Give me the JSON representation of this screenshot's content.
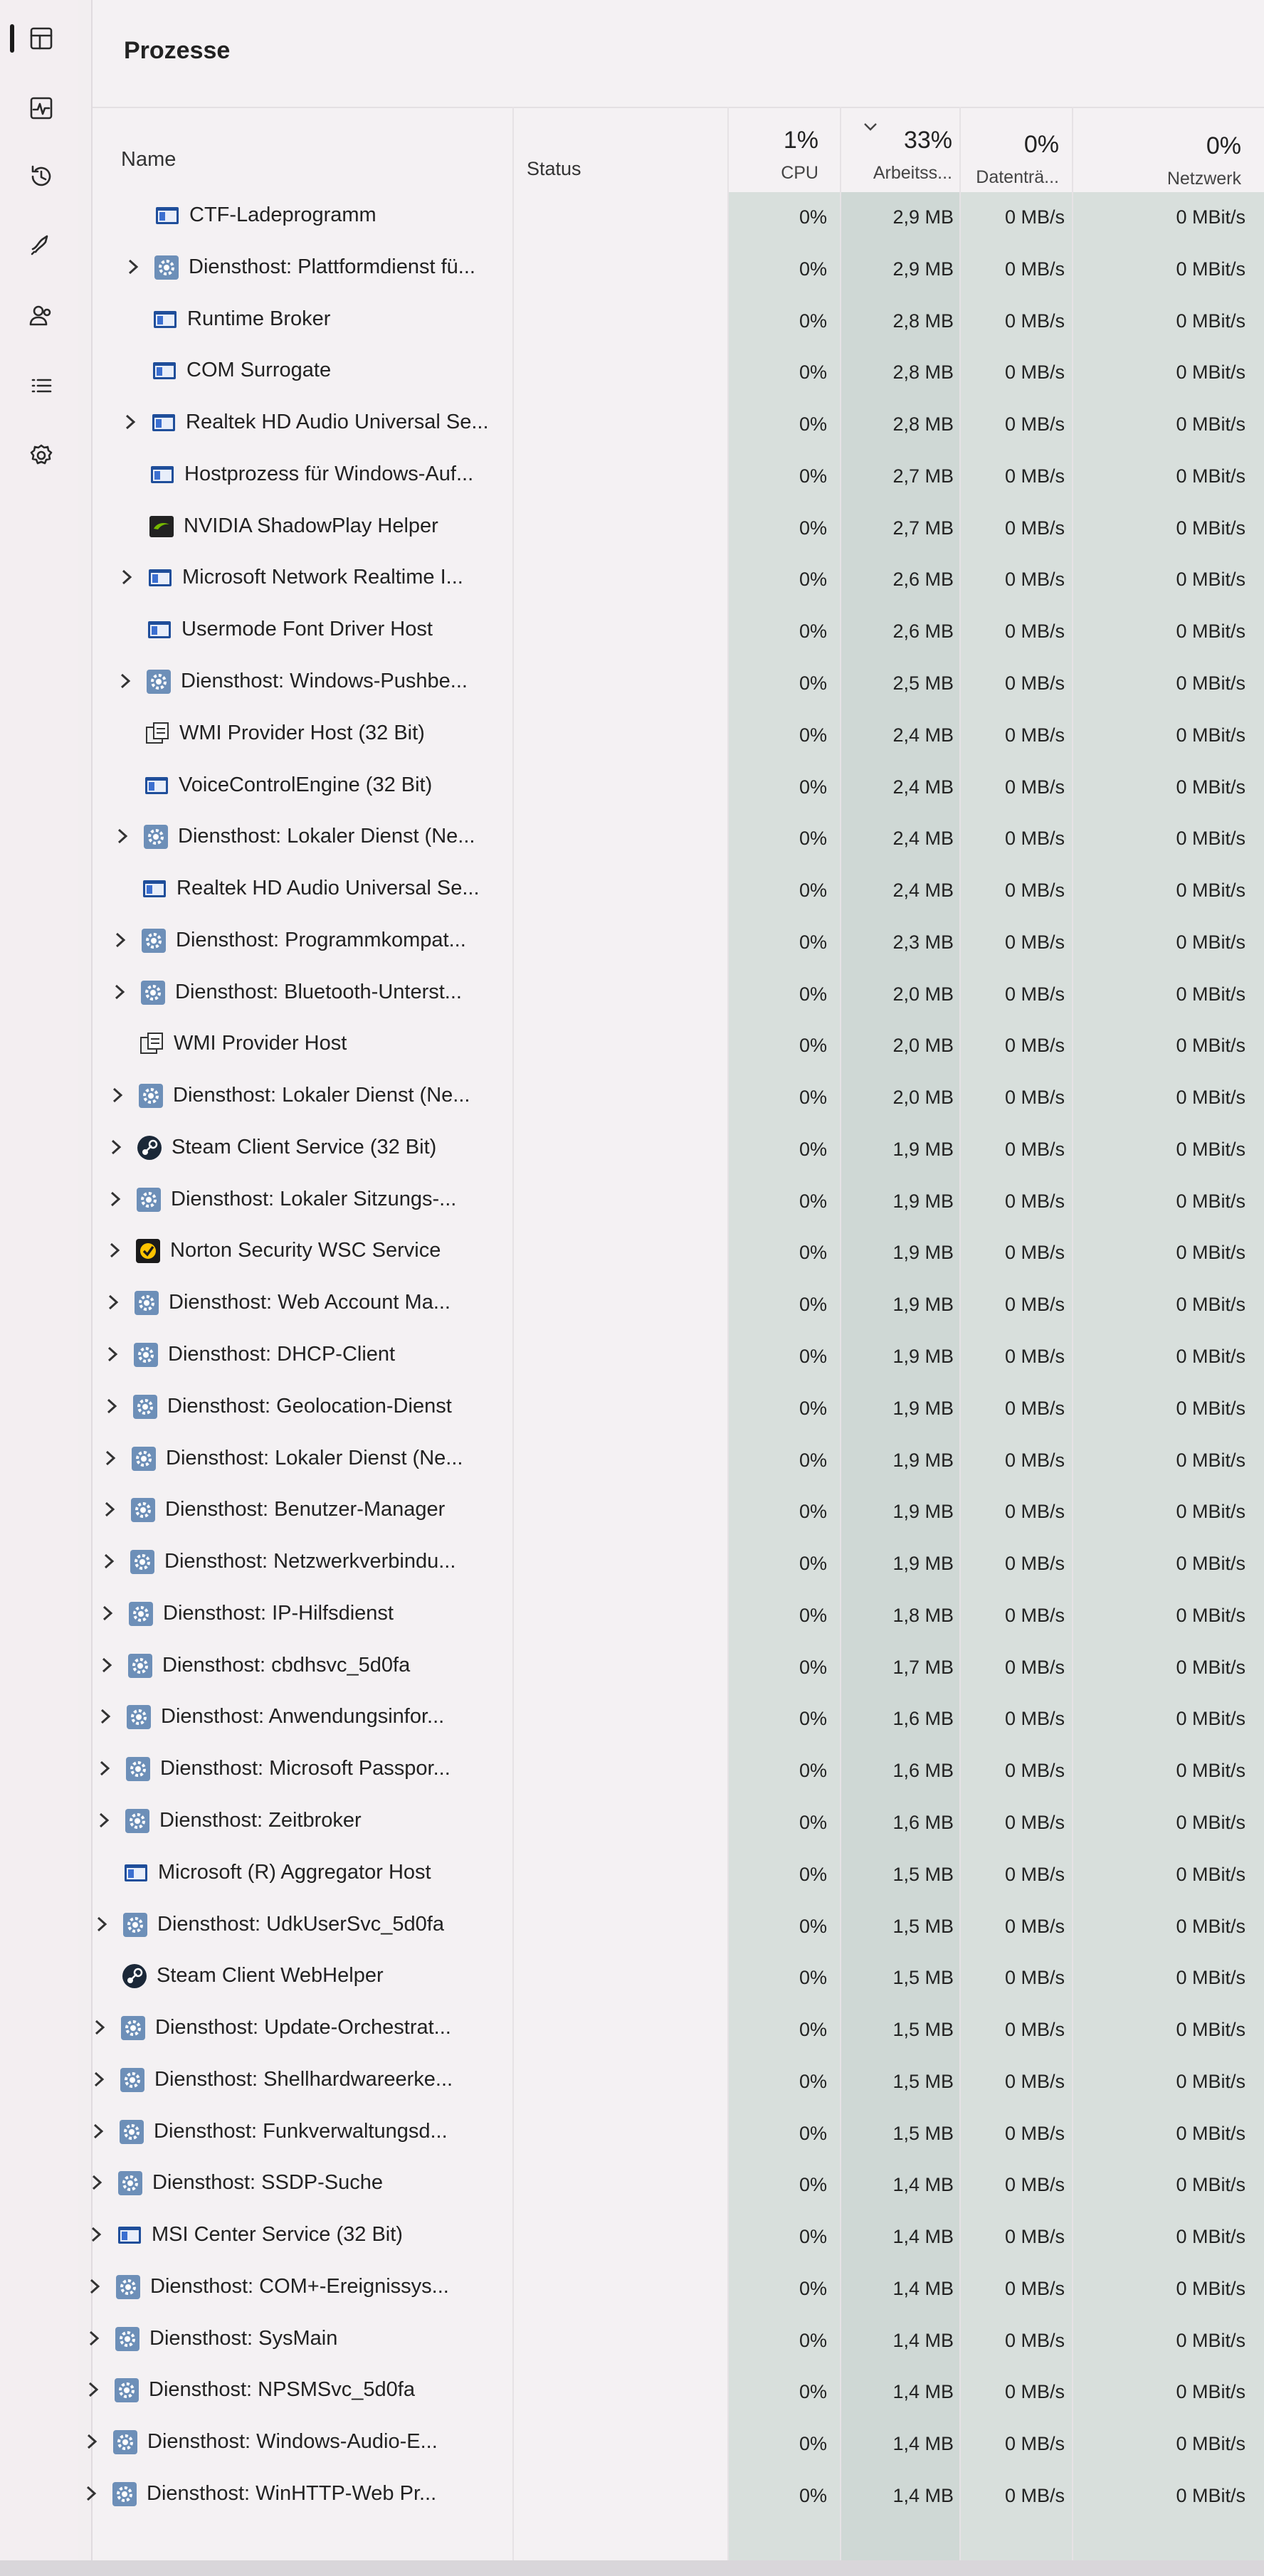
{
  "header": {
    "title": "Prozesse",
    "columns": {
      "name": "Name",
      "status": "Status",
      "cpu": {
        "pct": "1%",
        "label": "CPU"
      },
      "memory": {
        "pct": "33%",
        "label": "Arbeitss..."
      },
      "disk": {
        "pct": "0%",
        "label": "Datenträ..."
      },
      "network": {
        "pct": "0%",
        "label": "Netzwerk"
      }
    }
  },
  "nav": [
    {
      "name": "processes-icon"
    },
    {
      "name": "performance-icon"
    },
    {
      "name": "app-history-icon"
    },
    {
      "name": "startup-apps-icon"
    },
    {
      "name": "users-icon"
    },
    {
      "name": "details-icon"
    },
    {
      "name": "services-icon"
    }
  ],
  "rows": [
    {
      "name": "CTF-Ladeprogramm",
      "expand": false,
      "icon": "window-icon",
      "cpu": "0%",
      "mem": "2,9 MB",
      "disk": "0 MB/s",
      "net": "0 MBit/s"
    },
    {
      "name": "Diensthost: Plattformdienst fü...",
      "expand": true,
      "icon": "service-gear-icon",
      "cpu": "0%",
      "mem": "2,9 MB",
      "disk": "0 MB/s",
      "net": "0 MBit/s"
    },
    {
      "name": "Runtime Broker",
      "expand": false,
      "icon": "window-icon",
      "cpu": "0%",
      "mem": "2,8 MB",
      "disk": "0 MB/s",
      "net": "0 MBit/s"
    },
    {
      "name": "COM Surrogate",
      "expand": false,
      "icon": "window-icon",
      "cpu": "0%",
      "mem": "2,8 MB",
      "disk": "0 MB/s",
      "net": "0 MBit/s"
    },
    {
      "name": "Realtek HD Audio Universal Se...",
      "expand": true,
      "icon": "window-icon",
      "cpu": "0%",
      "mem": "2,8 MB",
      "disk": "0 MB/s",
      "net": "0 MBit/s"
    },
    {
      "name": "Hostprozess für Windows-Auf...",
      "expand": false,
      "icon": "window-icon",
      "cpu": "0%",
      "mem": "2,7 MB",
      "disk": "0 MB/s",
      "net": "0 MBit/s"
    },
    {
      "name": "NVIDIA ShadowPlay Helper",
      "expand": false,
      "icon": "nvidia-icon",
      "cpu": "0%",
      "mem": "2,7 MB",
      "disk": "0 MB/s",
      "net": "0 MBit/s"
    },
    {
      "name": "Microsoft Network Realtime I...",
      "expand": true,
      "icon": "window-icon",
      "cpu": "0%",
      "mem": "2,6 MB",
      "disk": "0 MB/s",
      "net": "0 MBit/s"
    },
    {
      "name": "Usermode Font Driver Host",
      "expand": false,
      "icon": "window-icon",
      "cpu": "0%",
      "mem": "2,6 MB",
      "disk": "0 MB/s",
      "net": "0 MBit/s"
    },
    {
      "name": "Diensthost: Windows-Pushbe...",
      "expand": true,
      "icon": "service-gear-icon",
      "cpu": "0%",
      "mem": "2,5 MB",
      "disk": "0 MB/s",
      "net": "0 MBit/s"
    },
    {
      "name": "WMI Provider Host (32 Bit)",
      "expand": false,
      "icon": "wmi-icon",
      "cpu": "0%",
      "mem": "2,4 MB",
      "disk": "0 MB/s",
      "net": "0 MBit/s"
    },
    {
      "name": "VoiceControlEngine (32 Bit)",
      "expand": false,
      "icon": "window-icon",
      "cpu": "0%",
      "mem": "2,4 MB",
      "disk": "0 MB/s",
      "net": "0 MBit/s"
    },
    {
      "name": "Diensthost: Lokaler Dienst (Ne...",
      "expand": true,
      "icon": "service-gear-icon",
      "cpu": "0%",
      "mem": "2,4 MB",
      "disk": "0 MB/s",
      "net": "0 MBit/s"
    },
    {
      "name": "Realtek HD Audio Universal Se...",
      "expand": false,
      "icon": "window-icon",
      "cpu": "0%",
      "mem": "2,4 MB",
      "disk": "0 MB/s",
      "net": "0 MBit/s"
    },
    {
      "name": "Diensthost: Programmkompat...",
      "expand": true,
      "icon": "service-gear-icon",
      "cpu": "0%",
      "mem": "2,3 MB",
      "disk": "0 MB/s",
      "net": "0 MBit/s"
    },
    {
      "name": "Diensthost: Bluetooth-Unterst...",
      "expand": true,
      "icon": "service-gear-icon",
      "cpu": "0%",
      "mem": "2,0 MB",
      "disk": "0 MB/s",
      "net": "0 MBit/s"
    },
    {
      "name": "WMI Provider Host",
      "expand": false,
      "icon": "wmi-icon",
      "cpu": "0%",
      "mem": "2,0 MB",
      "disk": "0 MB/s",
      "net": "0 MBit/s"
    },
    {
      "name": "Diensthost: Lokaler Dienst (Ne...",
      "expand": true,
      "icon": "service-gear-icon",
      "cpu": "0%",
      "mem": "2,0 MB",
      "disk": "0 MB/s",
      "net": "0 MBit/s"
    },
    {
      "name": "Steam Client Service (32 Bit)",
      "expand": true,
      "icon": "steam-icon",
      "cpu": "0%",
      "mem": "1,9 MB",
      "disk": "0 MB/s",
      "net": "0 MBit/s"
    },
    {
      "name": "Diensthost: Lokaler Sitzungs-...",
      "expand": true,
      "icon": "service-gear-icon",
      "cpu": "0%",
      "mem": "1,9 MB",
      "disk": "0 MB/s",
      "net": "0 MBit/s"
    },
    {
      "name": "Norton Security WSC Service",
      "expand": true,
      "icon": "norton-icon",
      "cpu": "0%",
      "mem": "1,9 MB",
      "disk": "0 MB/s",
      "net": "0 MBit/s"
    },
    {
      "name": "Diensthost: Web Account Ma...",
      "expand": true,
      "icon": "service-gear-icon",
      "cpu": "0%",
      "mem": "1,9 MB",
      "disk": "0 MB/s",
      "net": "0 MBit/s"
    },
    {
      "name": "Diensthost: DHCP-Client",
      "expand": true,
      "icon": "service-gear-icon",
      "cpu": "0%",
      "mem": "1,9 MB",
      "disk": "0 MB/s",
      "net": "0 MBit/s"
    },
    {
      "name": "Diensthost: Geolocation-Dienst",
      "expand": true,
      "icon": "service-gear-icon",
      "cpu": "0%",
      "mem": "1,9 MB",
      "disk": "0 MB/s",
      "net": "0 MBit/s"
    },
    {
      "name": "Diensthost: Lokaler Dienst (Ne...",
      "expand": true,
      "icon": "service-gear-icon",
      "cpu": "0%",
      "mem": "1,9 MB",
      "disk": "0 MB/s",
      "net": "0 MBit/s"
    },
    {
      "name": "Diensthost: Benutzer-Manager",
      "expand": true,
      "icon": "service-gear-icon",
      "cpu": "0%",
      "mem": "1,9 MB",
      "disk": "0 MB/s",
      "net": "0 MBit/s"
    },
    {
      "name": "Diensthost: Netzwerkverbindu...",
      "expand": true,
      "icon": "service-gear-icon",
      "cpu": "0%",
      "mem": "1,9 MB",
      "disk": "0 MB/s",
      "net": "0 MBit/s"
    },
    {
      "name": "Diensthost: IP-Hilfsdienst",
      "expand": true,
      "icon": "service-gear-icon",
      "cpu": "0%",
      "mem": "1,8 MB",
      "disk": "0 MB/s",
      "net": "0 MBit/s"
    },
    {
      "name": "Diensthost: cbdhsvc_5d0fa",
      "expand": true,
      "icon": "service-gear-icon",
      "cpu": "0%",
      "mem": "1,7 MB",
      "disk": "0 MB/s",
      "net": "0 MBit/s"
    },
    {
      "name": "Diensthost: Anwendungsinfor...",
      "expand": true,
      "icon": "service-gear-icon",
      "cpu": "0%",
      "mem": "1,6 MB",
      "disk": "0 MB/s",
      "net": "0 MBit/s"
    },
    {
      "name": "Diensthost: Microsoft Passpor...",
      "expand": true,
      "icon": "service-gear-icon",
      "cpu": "0%",
      "mem": "1,6 MB",
      "disk": "0 MB/s",
      "net": "0 MBit/s"
    },
    {
      "name": "Diensthost: Zeitbroker",
      "expand": true,
      "icon": "service-gear-icon",
      "cpu": "0%",
      "mem": "1,6 MB",
      "disk": "0 MB/s",
      "net": "0 MBit/s"
    },
    {
      "name": "Microsoft (R) Aggregator Host",
      "expand": false,
      "icon": "window-icon",
      "cpu": "0%",
      "mem": "1,5 MB",
      "disk": "0 MB/s",
      "net": "0 MBit/s"
    },
    {
      "name": "Diensthost: UdkUserSvc_5d0fa",
      "expand": true,
      "icon": "service-gear-icon",
      "cpu": "0%",
      "mem": "1,5 MB",
      "disk": "0 MB/s",
      "net": "0 MBit/s"
    },
    {
      "name": "Steam Client WebHelper",
      "expand": false,
      "icon": "steam-icon",
      "cpu": "0%",
      "mem": "1,5 MB",
      "disk": "0 MB/s",
      "net": "0 MBit/s"
    },
    {
      "name": "Diensthost: Update-Orchestrat...",
      "expand": true,
      "icon": "service-gear-icon",
      "cpu": "0%",
      "mem": "1,5 MB",
      "disk": "0 MB/s",
      "net": "0 MBit/s"
    },
    {
      "name": "Diensthost: Shellhardwareerke...",
      "expand": true,
      "icon": "service-gear-icon",
      "cpu": "0%",
      "mem": "1,5 MB",
      "disk": "0 MB/s",
      "net": "0 MBit/s"
    },
    {
      "name": "Diensthost: Funkverwaltungsd...",
      "expand": true,
      "icon": "service-gear-icon",
      "cpu": "0%",
      "mem": "1,5 MB",
      "disk": "0 MB/s",
      "net": "0 MBit/s"
    },
    {
      "name": "Diensthost: SSDP-Suche",
      "expand": true,
      "icon": "service-gear-icon",
      "cpu": "0%",
      "mem": "1,4 MB",
      "disk": "0 MB/s",
      "net": "0 MBit/s"
    },
    {
      "name": "MSI Center Service (32 Bit)",
      "expand": true,
      "icon": "window-icon",
      "cpu": "0%",
      "mem": "1,4 MB",
      "disk": "0 MB/s",
      "net": "0 MBit/s"
    },
    {
      "name": "Diensthost: COM+-Ereignissys...",
      "expand": true,
      "icon": "service-gear-icon",
      "cpu": "0%",
      "mem": "1,4 MB",
      "disk": "0 MB/s",
      "net": "0 MBit/s"
    },
    {
      "name": "Diensthost: SysMain",
      "expand": true,
      "icon": "service-gear-icon",
      "cpu": "0%",
      "mem": "1,4 MB",
      "disk": "0 MB/s",
      "net": "0 MBit/s"
    },
    {
      "name": "Diensthost: NPSMSvc_5d0fa",
      "expand": true,
      "icon": "service-gear-icon",
      "cpu": "0%",
      "mem": "1,4 MB",
      "disk": "0 MB/s",
      "net": "0 MBit/s"
    },
    {
      "name": "Diensthost: Windows-Audio-E...",
      "expand": true,
      "icon": "service-gear-icon",
      "cpu": "0%",
      "mem": "1,4 MB",
      "disk": "0 MB/s",
      "net": "0 MBit/s"
    },
    {
      "name": "Diensthost: WinHTTP-Web Pr...",
      "expand": true,
      "icon": "service-gear-icon",
      "cpu": "0%",
      "mem": "1,4 MB",
      "disk": "0 MB/s",
      "net": "0 MBit/s"
    }
  ]
}
